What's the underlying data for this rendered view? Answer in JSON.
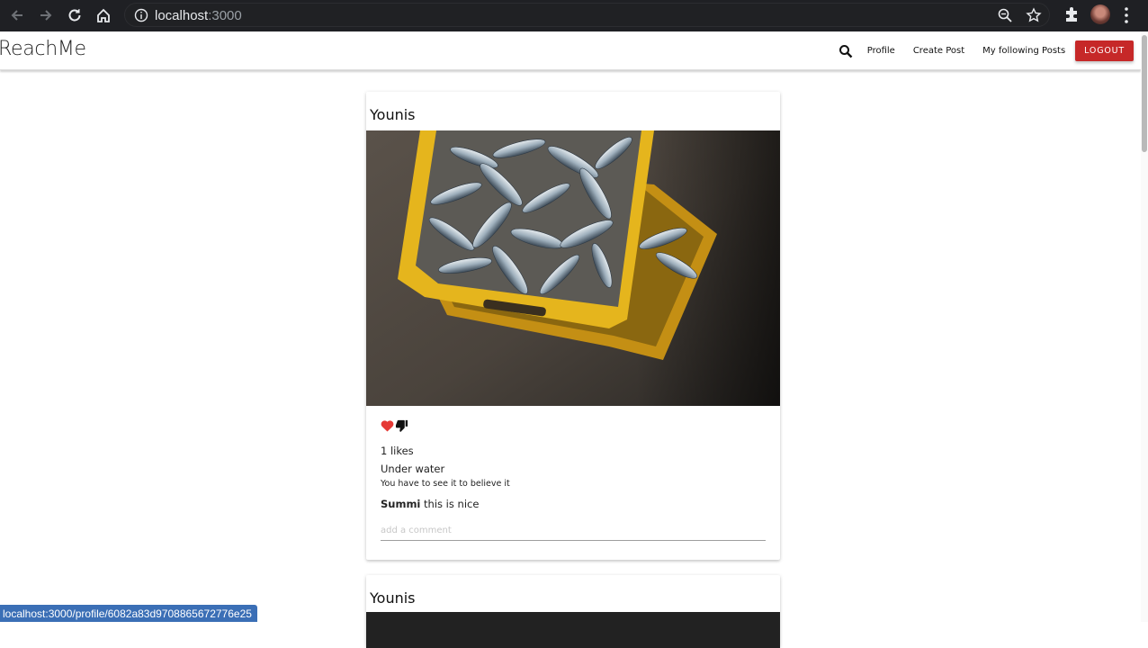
{
  "browser": {
    "url_host": "localhost",
    "url_port": ":3000",
    "icons": [
      "back-icon",
      "forward-icon",
      "reload-icon",
      "home-icon",
      "info-icon",
      "zoom-icon",
      "star-icon",
      "extensions-icon",
      "menu-icon"
    ]
  },
  "navbar": {
    "brand": "ReachMe",
    "links": {
      "profile": "Profile",
      "create_post": "Create Post",
      "following": "My following Posts"
    },
    "logout": "LOGOUT",
    "logout_color": "#c62828"
  },
  "posts": [
    {
      "author": "Younis",
      "likes_text": "1 likes",
      "title": "Under water",
      "body": "You have to see it to believe it",
      "comment": {
        "user": "Summi",
        "text": "this is nice"
      },
      "comment_placeholder": "add a comment",
      "like_color": "#e53935"
    },
    {
      "author": "Younis"
    }
  ],
  "statusbar": {
    "link": "localhost:3000/profile/6082a83d9708865672776e25"
  }
}
